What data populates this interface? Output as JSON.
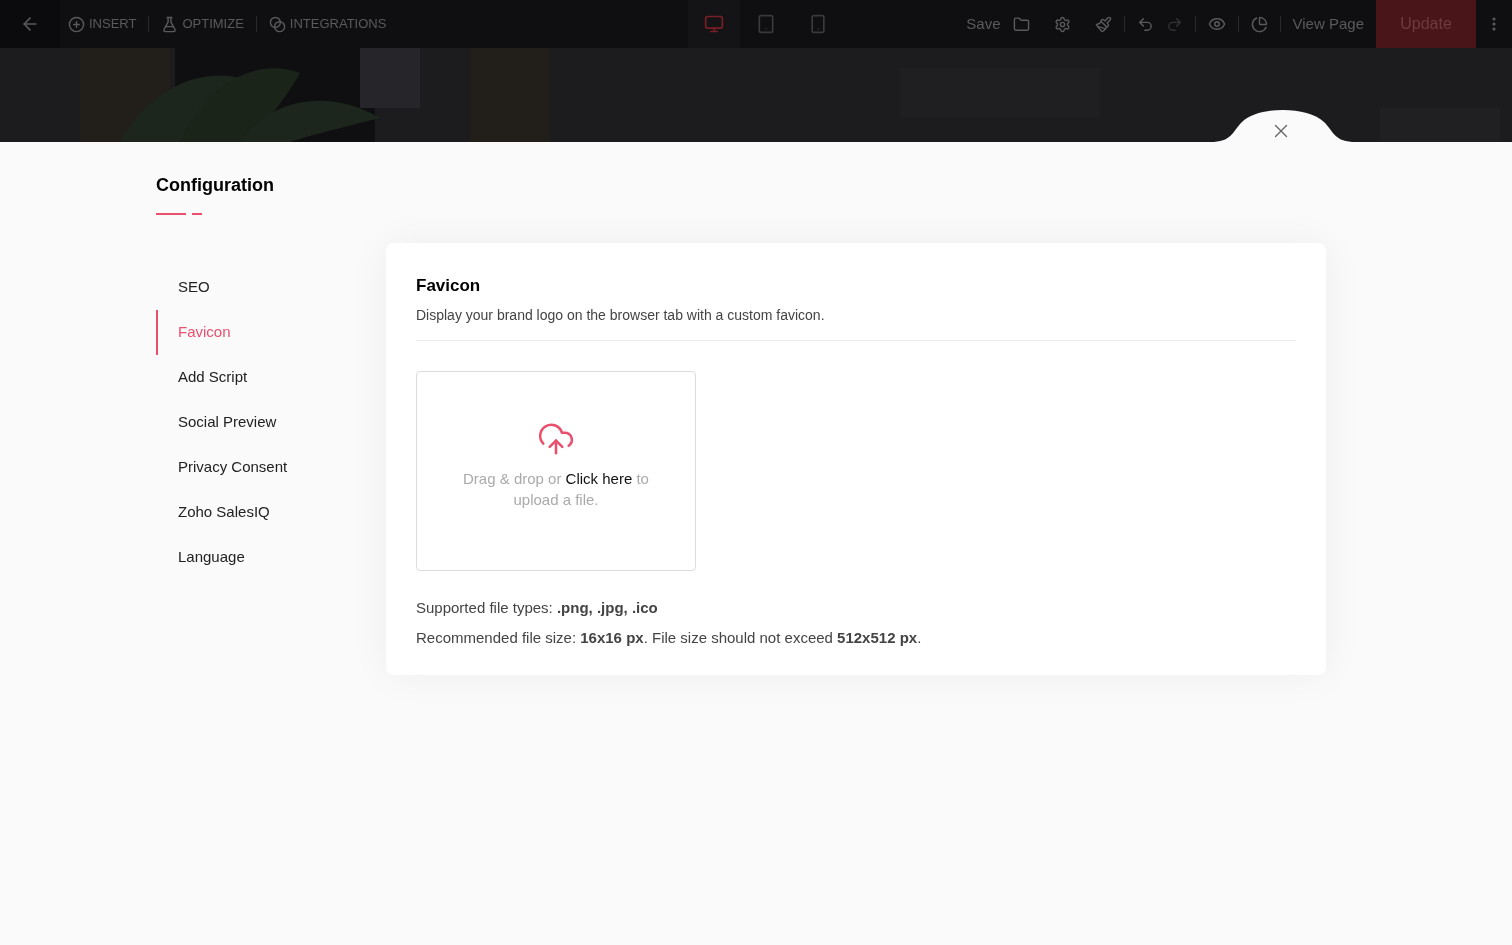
{
  "toolbar": {
    "menus": [
      {
        "kind": "insert",
        "label": "INSERT"
      },
      {
        "kind": "optimize",
        "label": "OPTIMIZE"
      },
      {
        "kind": "integrations",
        "label": "INTEGRATIONS"
      }
    ],
    "devices": [
      {
        "kind": "desktop",
        "selected": true
      },
      {
        "kind": "tablet",
        "selected": false
      },
      {
        "kind": "mobile",
        "selected": false
      }
    ],
    "save": "Save",
    "view_page": "View Page",
    "update": "Update"
  },
  "page_title": "Configuration",
  "sidebar": {
    "items": [
      {
        "label": "SEO",
        "selected": false
      },
      {
        "label": "Favicon",
        "selected": true
      },
      {
        "label": "Add Script",
        "selected": false
      },
      {
        "label": "Social Preview",
        "selected": false
      },
      {
        "label": "Privacy Consent",
        "selected": false
      },
      {
        "label": "Zoho SalesIQ",
        "selected": false
      },
      {
        "label": "Language",
        "selected": false
      }
    ]
  },
  "card": {
    "title": "Favicon",
    "description": "Display your brand logo on the browser tab with a custom favicon.",
    "dropzone": {
      "before": "Drag & drop or ",
      "link": "Click here",
      "after": " to upload a file."
    },
    "notes": [
      "Supported file types: **.png, .jpg, .ico**",
      "Recommended file size: **16x16 px**. File size should not exceed **512x512 px**."
    ]
  }
}
